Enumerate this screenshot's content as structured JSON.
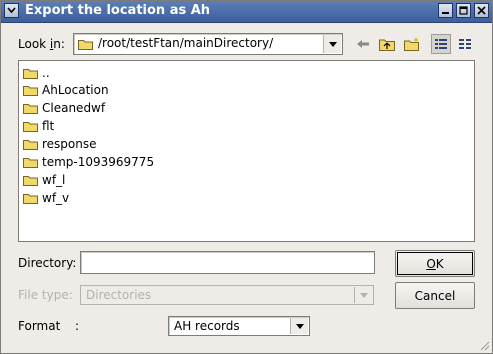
{
  "window": {
    "title": "Export the location as Ah",
    "buttons": [
      "minimize",
      "maximize",
      "close"
    ]
  },
  "lookin": {
    "label_pre": "Look ",
    "label_u": "i",
    "label_post": "n:",
    "path": "/root/testFtan/mainDirectory/"
  },
  "toolbar": {
    "icons": [
      "back-arrow-icon",
      "parent-folder-icon",
      "new-folder-icon",
      "detail-view-icon",
      "list-view-icon"
    ]
  },
  "files": [
    "..",
    "AhLocation",
    "Cleanedwf",
    "flt",
    "response",
    "temp-1093969775",
    "wf_l",
    "wf_v"
  ],
  "directory": {
    "label": "Directory:",
    "value": ""
  },
  "filetype": {
    "label": "File type:",
    "value": "Directories"
  },
  "format": {
    "label": "Format",
    "colon": ":",
    "value": "AH records"
  },
  "buttons": {
    "ok_u": "O",
    "ok_rest": "K",
    "cancel": "Cancel"
  },
  "colors": {
    "titlebar": "#3d5f9c",
    "folder": "#f1d86a",
    "window_bg": "#efebe7"
  }
}
